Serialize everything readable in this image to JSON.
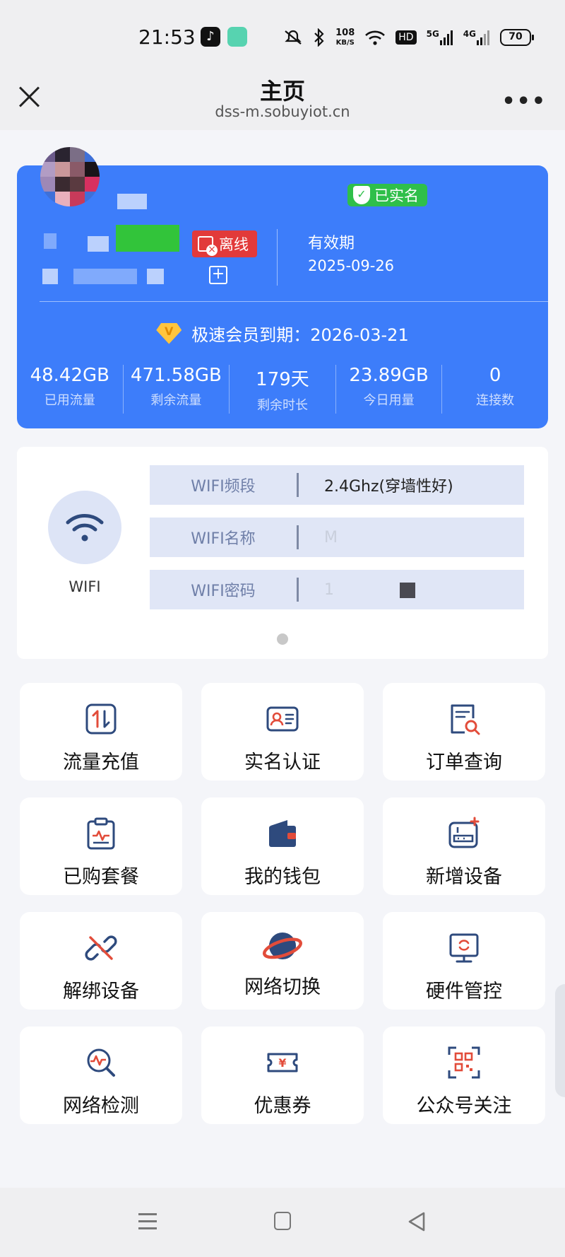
{
  "status_bar": {
    "time": "21:53",
    "net_speed_value": "108",
    "net_speed_unit": "KB/S",
    "hd_label": "HD",
    "signal1": "5G",
    "signal2": "4G",
    "battery": "70"
  },
  "header": {
    "title": "主页",
    "url": "dss-m.sobuyiot.cn"
  },
  "device_card": {
    "realname_badge": "已实名",
    "status_badge": "离线",
    "validity_label": "有效期",
    "validity_date": "2025-09-26",
    "vip_text": "极速会员到期：2026-03-21",
    "stats": [
      {
        "value": "48.42GB",
        "label": "已用流量"
      },
      {
        "value": "471.58GB",
        "label": "剩余流量"
      },
      {
        "value": "179天",
        "label": "剩余时长"
      },
      {
        "value": "23.89GB",
        "label": "今日用量"
      },
      {
        "value": "0",
        "label": "连接数"
      }
    ]
  },
  "wifi": {
    "icon_label": "WIFI",
    "rows": [
      {
        "key": "WIFI频段",
        "value": "2.4Ghz(穿墙性好)"
      },
      {
        "key": "WIFI名称",
        "value": "M"
      },
      {
        "key": "WIFI密码",
        "value": "1"
      }
    ]
  },
  "menu": [
    {
      "label": "流量充值",
      "icon": "traffic-recharge-icon"
    },
    {
      "label": "实名认证",
      "icon": "id-card-icon"
    },
    {
      "label": "订单查询",
      "icon": "order-search-icon"
    },
    {
      "label": "已购套餐",
      "icon": "clipboard-package-icon"
    },
    {
      "label": "我的钱包",
      "icon": "wallet-icon"
    },
    {
      "label": "新增设备",
      "icon": "add-device-icon"
    },
    {
      "label": "解绑设备",
      "icon": "unlink-icon"
    },
    {
      "label": "网络切换",
      "icon": "planet-icon"
    },
    {
      "label": "硬件管控",
      "icon": "monitor-icon"
    },
    {
      "label": "网络检测",
      "icon": "network-check-icon"
    },
    {
      "label": "优惠券",
      "icon": "coupon-icon"
    },
    {
      "label": "公众号关注",
      "icon": "qrcode-icon"
    }
  ],
  "colors": {
    "card_blue": "#3d7dfa",
    "badge_green": "#2fbf4a",
    "badge_red": "#e23a3a",
    "icon_navy": "#2e4a7d",
    "icon_red": "#e24c3a"
  }
}
